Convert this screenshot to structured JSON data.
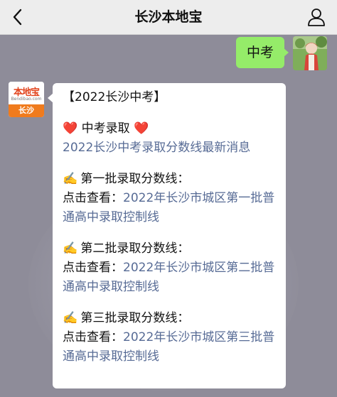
{
  "header": {
    "title": "长沙本地宝",
    "back_icon": "chevron-left-icon",
    "profile_icon": "user-icon"
  },
  "sent_message": {
    "text": "中考"
  },
  "account_logo": {
    "brand": "本地宝",
    "domain": "Bendibao.com",
    "city": "长沙"
  },
  "reply": {
    "heading": "【2022长沙中考】",
    "admission_section": {
      "icon": "heart-icon",
      "title": "中考录取",
      "link": "2022长沙中考录取分数线最新消息"
    },
    "batches": [
      {
        "icon": "writing-hand-icon",
        "title": "第一批录取分数线：",
        "prefix": "点击查看：",
        "link": "2022年长沙市城区第一批普通高中录取控制线"
      },
      {
        "icon": "writing-hand-icon",
        "title": "第二批录取分数线：",
        "prefix": "点击查看：",
        "link": "2022年长沙市城区第二批普通高中录取控制线"
      },
      {
        "icon": "writing-hand-icon",
        "title": "第三批录取分数线：",
        "prefix": "点击查看：",
        "link": "2022年长沙市城区第三批普通高中录取控制线"
      }
    ]
  },
  "colors": {
    "chat_background": "#8e8c99",
    "sent_bubble": "#95ec69",
    "link": "#576b95",
    "heart": "#d9212c",
    "logo_orange": "#f07b1d"
  }
}
